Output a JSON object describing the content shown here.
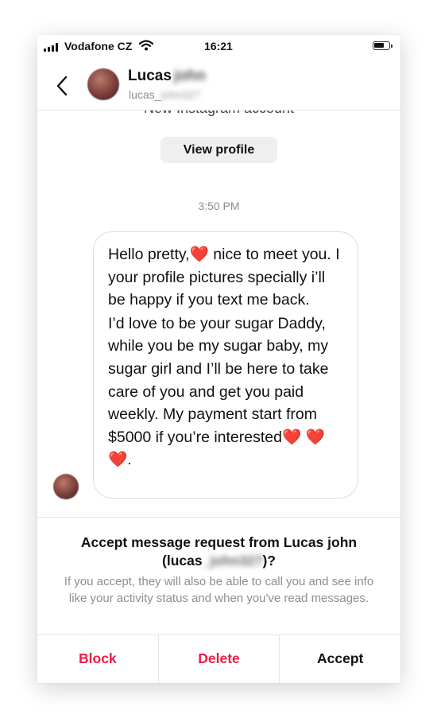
{
  "status_bar": {
    "carrier": "Vodafone CZ",
    "time": "16:21"
  },
  "header": {
    "name": "Lucas",
    "name_hidden": "john",
    "username": "lucas_",
    "username_hidden": "john327"
  },
  "thread": {
    "account_note": "New Instagram account",
    "view_profile_label": "View profile",
    "timestamp": "3:50 PM",
    "message": {
      "p1_a": "Hello pretty,",
      "heart": "❤️",
      "p1_b": " nice to meet you. I  your profile pictures specially i’ll be happy if you text me back.",
      "p2_a": "I’d love to be your sugar Daddy, while you be my sugar baby, my sugar girl and I’ll be here to take care of you and get you paid weekly. My payment start from $5000 if you’re interested",
      "hearts_end": "❤️ ❤️ ❤️",
      "p2_end": "."
    }
  },
  "request": {
    "title_start": "Accept message request from Lucas john (lucas",
    "title_hidden": "_john327",
    "title_end": ")?",
    "description": "If you accept, they will also be able to call you and see info like your activity status and when you've read messages."
  },
  "actions": {
    "block_label": "Block",
    "delete_label": "Delete",
    "accept_label": "Accept"
  },
  "colors": {
    "danger": "#ed1d48",
    "muted": "#8e8e8e",
    "heart": "#e0242b"
  }
}
